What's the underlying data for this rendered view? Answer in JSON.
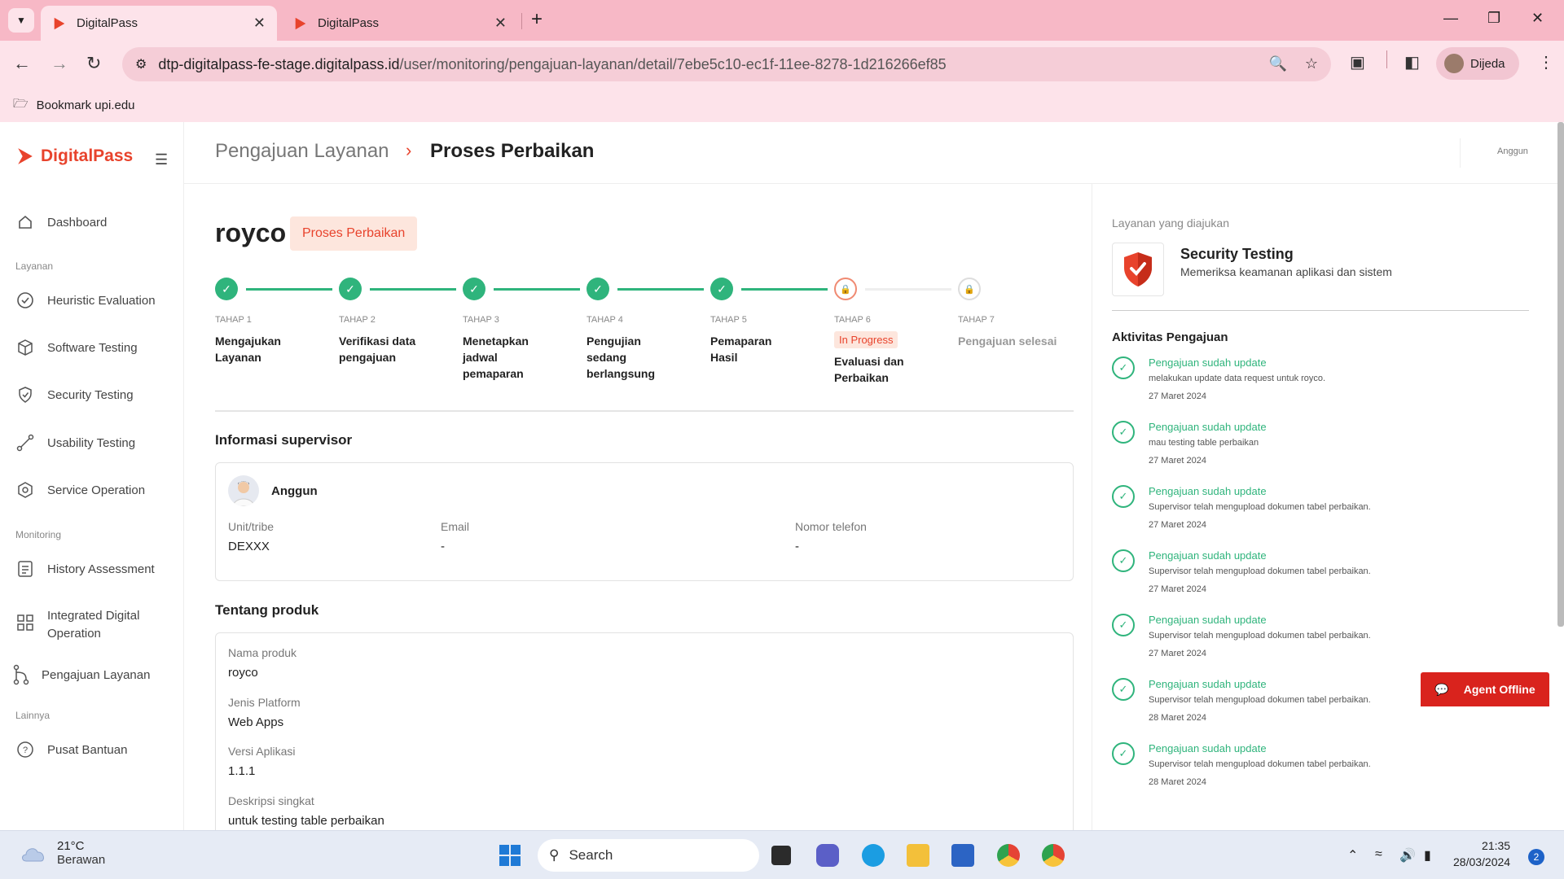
{
  "browser": {
    "tabs": [
      {
        "title": "DigitalPass"
      },
      {
        "title": "DigitalPass"
      }
    ],
    "url_host": "dtp-digitalpass-fe-stage.digitalpass.id",
    "url_path": "/user/monitoring/pengajuan-layanan/detail/7ebe5c10-ec1f-11ee-8278-1d216266ef85",
    "profile_name": "Dijeda",
    "bookmark": "Bookmark upi.edu"
  },
  "sidebar": {
    "brand": "DigitalPass",
    "items": [
      {
        "label": "Dashboard",
        "icon": "home-icon"
      },
      {
        "section": "Layanan"
      },
      {
        "label": "Heuristic Evaluation",
        "icon": "check-circle-icon"
      },
      {
        "label": "Software Testing",
        "icon": "box-icon"
      },
      {
        "label": "Security Testing",
        "icon": "shield-icon"
      },
      {
        "label": "Usability Testing",
        "icon": "path-icon"
      },
      {
        "label": "Service Operation",
        "icon": "gear-hex-icon"
      },
      {
        "section": "Monitoring"
      },
      {
        "label": "History Assessment",
        "icon": "document-icon"
      },
      {
        "label": "Integrated Digital Operation",
        "icon": "grid-icon"
      },
      {
        "label": "Pengajuan Layanan",
        "icon": "branch-icon"
      },
      {
        "section": "Lainnya"
      },
      {
        "label": "Pusat Bantuan",
        "icon": "help-icon"
      }
    ]
  },
  "header": {
    "crumb_parent": "Pengajuan Layanan",
    "crumb_current": "Proses Perbaikan",
    "user": "Anggun"
  },
  "main": {
    "product_name": "royco",
    "status_badge": "Proses Perbaikan",
    "steps": [
      {
        "num": "TAHAP 1",
        "name": "Mengajukan Layanan",
        "state": "done"
      },
      {
        "num": "TAHAP 2",
        "name": "Verifikasi data pengajuan",
        "state": "done"
      },
      {
        "num": "TAHAP 3",
        "name": "Menetapkan jadwal pemaparan",
        "state": "done"
      },
      {
        "num": "TAHAP 4",
        "name": "Pengujian sedang berlangsung",
        "state": "done"
      },
      {
        "num": "TAHAP 5",
        "name": "Pemaparan Hasil",
        "state": "done"
      },
      {
        "num": "TAHAP 6",
        "name": "Evaluasi dan Perbaikan",
        "state": "progress",
        "badge": "In Progress"
      },
      {
        "num": "TAHAP 7",
        "name": "Pengajuan selesai",
        "state": "locked"
      }
    ],
    "supervisor": {
      "heading": "Informasi supervisor",
      "name": "Anggun",
      "unit_label": "Unit/tribe",
      "unit_value": "DEXXX",
      "email_label": "Email",
      "email_value": "-",
      "phone_label": "Nomor telefon",
      "phone_value": "-"
    },
    "product": {
      "heading": "Tentang produk",
      "fields": [
        {
          "label": "Nama produk",
          "value": "royco"
        },
        {
          "label": "Jenis Platform",
          "value": "Web Apps"
        },
        {
          "label": "Versi Aplikasi",
          "value": "1.1.1"
        },
        {
          "label": "Deskripsi singkat",
          "value": "untuk testing table perbaikan"
        }
      ]
    }
  },
  "right_panel": {
    "label": "Layanan yang diajukan",
    "service_title": "Security Testing",
    "service_desc": "Memeriksa keamanan aplikasi dan sistem",
    "activity_heading": "Aktivitas Pengajuan",
    "activities": [
      {
        "title": "Pengajuan sudah update",
        "desc": "melakukan update data request untuk royco.",
        "date": "27 Maret 2024"
      },
      {
        "title": "Pengajuan sudah update",
        "desc": "mau testing table perbaikan",
        "date": "27 Maret 2024"
      },
      {
        "title": "Pengajuan sudah update",
        "desc": "Supervisor telah mengupload dokumen tabel perbaikan.",
        "date": "27 Maret 2024"
      },
      {
        "title": "Pengajuan sudah update",
        "desc": "Supervisor telah mengupload dokumen tabel perbaikan.",
        "date": "27 Maret 2024"
      },
      {
        "title": "Pengajuan sudah update",
        "desc": "Supervisor telah mengupload dokumen tabel perbaikan.",
        "date": "27 Maret 2024"
      },
      {
        "title": "Pengajuan sudah update",
        "desc": "Supervisor telah mengupload dokumen tabel perbaikan.",
        "date": "28 Maret 2024"
      },
      {
        "title": "Pengajuan sudah update",
        "desc": "Supervisor telah mengupload dokumen tabel perbaikan.",
        "date": "28 Maret 2024"
      }
    ]
  },
  "agent_button": "Agent Offline",
  "taskbar": {
    "temp": "21°C",
    "weather": "Berawan",
    "search_placeholder": "Search",
    "time": "21:35",
    "date": "28/03/2024",
    "notifications": "2"
  },
  "colors": {
    "brand": "#e8432c",
    "success": "#2fb47c",
    "chrome_pink": "#fde3ea"
  }
}
